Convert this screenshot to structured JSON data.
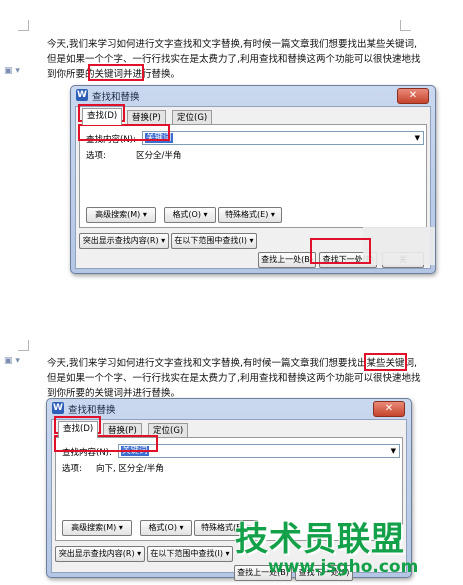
{
  "paragraph_lines": [
    "今天,我们来学习如何进行文字查找和文字替换,有时候一篇文章我们想要找出某些关键词,",
    "但是如果一个个字、一行行找实在是太费力了,利用查找和替换这两个功能可以很快速地找",
    "到你所要的关键词并进行替换。"
  ],
  "dialog_title": "查找和替换",
  "close_glyph": "✕",
  "app_icon_glyph": "W",
  "margin_icon_glyph": "▣ ▾",
  "tabs": [
    "查找(D)",
    "替换(P)",
    "定位(G)"
  ],
  "find_label": "查找内容(N):",
  "find_value": "关键词",
  "dropdown_glyph": "▼",
  "options_label": "选项:",
  "options_value_1": "区分全/半角",
  "options_value_2": "向下, 区分全/半角",
  "buttons": {
    "advanced_search": "高级搜索(M) ▾",
    "format": "格式(O) ▾",
    "special_format": "特殊格式(E) ▾",
    "highlight_results": "突出显示查找内容(R) ▾",
    "find_in_range": "在以下范围中查找(I) ▾",
    "find_previous": "查找上一处(B)",
    "find_next": "查找下一处(F)",
    "close": "关"
  },
  "watermark": {
    "text": "技术员联盟",
    "url": "www.jsgho.com"
  },
  "colors": {
    "annotation_red": "#e0112b",
    "watermark_green": "#12a049",
    "selection_blue": "#3e6ed2"
  }
}
